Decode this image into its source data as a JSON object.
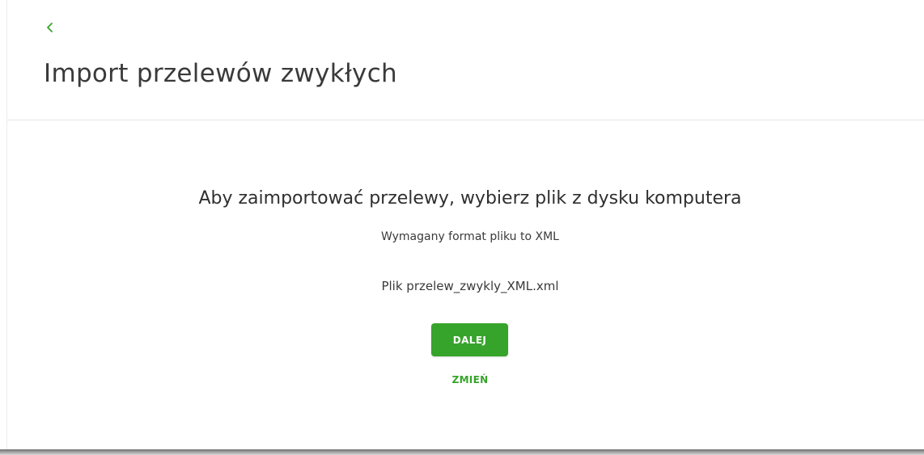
{
  "header": {
    "back_icon": "chevron-left-icon",
    "title": "Import przelewów zwykłych"
  },
  "main": {
    "instruction": "Aby zaimportować przelewy, wybierz plik z dysku komputera",
    "format_note": "Wymagany format pliku to XML",
    "file_line": "Plik przelew_zwykly_XML.xml",
    "next_label": "DALEJ",
    "change_label": "ZMIEŃ"
  },
  "colors": {
    "accent": "#36a42a",
    "text": "#3a3a3a",
    "divider": "#e6e6e6"
  }
}
